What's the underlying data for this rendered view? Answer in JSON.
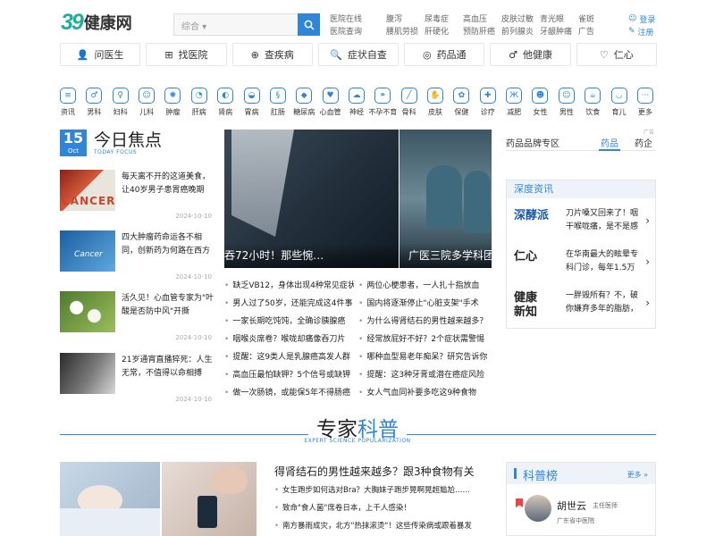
{
  "header": {
    "logo_mark": "39",
    "logo_name": "健康网",
    "search_type": "综合",
    "search_placeholder": "",
    "links": [
      "医院在线",
      "医院查询",
      "腹泻",
      "腰肌劳损",
      "尿毒症",
      "肝硬化",
      "高血压",
      "预防肝癌",
      "皮肤过敏",
      "前列腺炎",
      "青光眼",
      "牙龈肿痛",
      "雀斑",
      "广告"
    ],
    "login": "登录",
    "register": "注册"
  },
  "nav": [
    {
      "label": "问医生",
      "icon": "user-icon"
    },
    {
      "label": "找医院",
      "icon": "hospital-icon"
    },
    {
      "label": "查疾病",
      "icon": "search-plus-icon"
    },
    {
      "label": "症状自查",
      "icon": "symptom-icon"
    },
    {
      "label": "药品通",
      "icon": "pill-icon"
    },
    {
      "label": "他健康",
      "icon": "mars-icon"
    },
    {
      "label": "仁心",
      "icon": "heart-icon"
    }
  ],
  "categories": [
    "资讯",
    "男科",
    "妇科",
    "儿科",
    "肿瘤",
    "肝病",
    "肾病",
    "胃病",
    "肛肠",
    "糖尿病",
    "心血管",
    "神经",
    "不孕不育",
    "骨科",
    "皮肤",
    "保健",
    "诊疗",
    "减肥",
    "女性",
    "男性",
    "饮食",
    "育儿",
    "更多"
  ],
  "focus": {
    "day": "15",
    "month": "Oct",
    "title": "今日焦点",
    "subtitle": "TODAY FOCUS",
    "items": [
      {
        "text": "每天离不开的这道美食，让40岁男子患胃癌晚期",
        "time": "2024-10-10",
        "img_word": "CANCER"
      },
      {
        "text": "四大肿瘤药命运各不相同，创新药为何路在西方",
        "time": "2024-10-10",
        "img_word": "Cancer"
      },
      {
        "text": "活久见！心血管专家为\"叶酸是否防中风\"开撕",
        "time": "2024-10-10",
        "img_word": ""
      },
      {
        "text": "21岁通宵直播猝死：人生无常，不值得以命相搏",
        "time": "2024-10-10",
        "img_word": ""
      }
    ]
  },
  "slider": {
    "caption1": "吞72小时！那些惋…",
    "caption2": "广医三院多学科团"
  },
  "news": {
    "left": [
      "缺乏VB12，身体出现4种常见症状",
      "男人过了50岁，还能完成这4件事",
      "一家长期吃饨饨，全确诊胰腺癌",
      "咽喉炎席卷？喉咙却痛像吞刀片",
      "提醒：这9类人是乳腺癌高发人群",
      "高血压最怕缺钾？5个信号或缺钾",
      "做一次肠镜，或能保5年不得肠癌"
    ],
    "right": [
      "两位心梗患者，一人扎十指放血",
      "国内将逐渐停止\"心脏支架\"手术",
      "为什么得肾结石的男性越来越多？",
      "经常放屁好不好？2个症状需警惕",
      "哪种血型易老年痴呆？研究告诉你",
      "提醒：这3种牙膏或潜在癌症风险",
      "女人气血同补要多吃这9种食物"
    ]
  },
  "brand": {
    "title": "药品品牌专区",
    "tab1": "药品",
    "tab2": "药企",
    "ad": "广告"
  },
  "deep": {
    "title": "深度资讯",
    "items": [
      {
        "logo": "深酵派",
        "text": "刀片嗓又回来了！咽干喉咙痛，是不是感"
      },
      {
        "logo": "仁心",
        "text": "在华南最大的眩晕专科门诊，每年1.5万"
      },
      {
        "logo": "健康新知",
        "text": "一胖毁所有？不，破你嫌弃多年的脂肪，"
      }
    ]
  },
  "expert": {
    "title_a": "专家",
    "title_b": "科普",
    "subtitle": "EXPERT SCIENCE POPULARIZATION"
  },
  "bottom": {
    "title": "得肾结石的男性越来越多？跟3种食物有关",
    "list": [
      "女生跑步如何选对Bra？大胸妹子跑步晃啊晃超尴尬……",
      "致命\"食人菌\"席卷日本，上千人感染！",
      "南方暴雨成灾，北方\"热抹滚烫\"！这些传染病或跟着暴发"
    ]
  },
  "rank": {
    "title": "科普榜",
    "more": "更多",
    "doctor_name": "胡世云",
    "doctor_title": "主任医师",
    "doctor_hospital": "广东省中医院"
  },
  "colors": {
    "accent": "#2f86d9",
    "logo": "#1fae9b"
  }
}
